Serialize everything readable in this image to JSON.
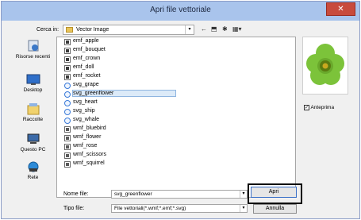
{
  "window": {
    "title": "Apri file vettoriale",
    "close_glyph": "✕"
  },
  "lookin": {
    "label": "Cerca in:",
    "value": "Vector Image",
    "arrow": "▾"
  },
  "toolbar": {
    "back": "←",
    "up_folder": "⬒",
    "new_folder": "✱",
    "view_menu": "▦▾"
  },
  "places": [
    {
      "label": "Risorse recenti",
      "icon": "recent-places-icon"
    },
    {
      "label": "Desktop",
      "icon": "desktop-icon"
    },
    {
      "label": "Raccolte",
      "icon": "libraries-icon"
    },
    {
      "label": "Questo PC",
      "icon": "computer-icon"
    },
    {
      "label": "Rete",
      "icon": "network-icon"
    }
  ],
  "files": [
    {
      "name": "emf_apple",
      "kind": "emf"
    },
    {
      "name": "emf_bouquet",
      "kind": "emf"
    },
    {
      "name": "emf_crown",
      "kind": "emf"
    },
    {
      "name": "emf_doll",
      "kind": "emf"
    },
    {
      "name": "emf_rocket",
      "kind": "emf"
    },
    {
      "name": "svg_grape",
      "kind": "svg"
    },
    {
      "name": "svg_greenflower",
      "kind": "svg",
      "selected": true
    },
    {
      "name": "svg_heart",
      "kind": "svg"
    },
    {
      "name": "svg_ship",
      "kind": "svg"
    },
    {
      "name": "svg_whale",
      "kind": "svg"
    },
    {
      "name": "wmf_bluebird",
      "kind": "wmf"
    },
    {
      "name": "wmf_flower",
      "kind": "wmf"
    },
    {
      "name": "wmf_rose",
      "kind": "wmf"
    },
    {
      "name": "wmf_scissors",
      "kind": "wmf"
    },
    {
      "name": "wmf_squirrel",
      "kind": "wmf"
    }
  ],
  "preview": {
    "anteprima_label": "Anteprima",
    "anteprima_checked": true,
    "check_glyph": "✓"
  },
  "filename": {
    "label": "Nome file:",
    "value": "svg_greenflower",
    "arrow": "▾"
  },
  "filetype": {
    "label": "Tipo file:",
    "value": "File vettoriali(*.wmf;*.emf;*.svg)",
    "arrow": "▾"
  },
  "buttons": {
    "open": "Apri",
    "cancel": "Annulla"
  },
  "colors": {
    "petal_green": "#7cc33a",
    "center_dark": "#5a7a10",
    "center_yellow": "#c8a820",
    "titlebar": "#a9c4ec"
  }
}
